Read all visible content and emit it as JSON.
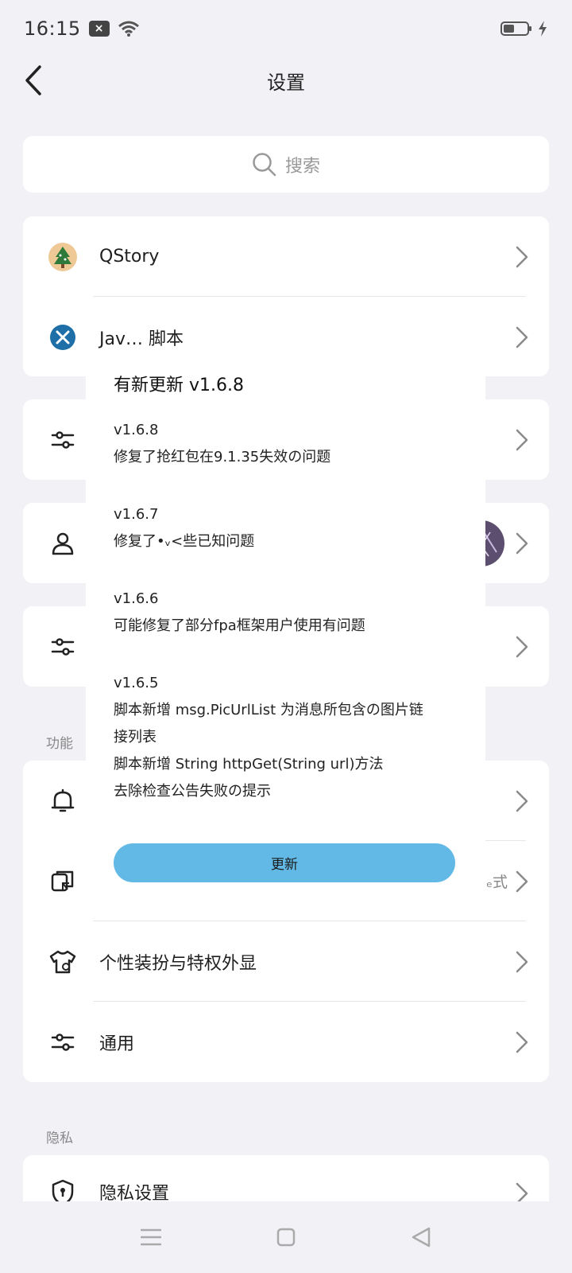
{
  "status_bar": {
    "time": "16:15",
    "notif_badge": "×"
  },
  "top_bar": {
    "title": "设置"
  },
  "search": {
    "placeholder": "搜索"
  },
  "card1": {
    "items": [
      {
        "label": "QStory"
      },
      {
        "label": "Jav… 脚本"
      }
    ]
  },
  "hidden_rows": {
    "row4_right_text": "ₑ式"
  },
  "section_function": {
    "title": "功能"
  },
  "function_items": [
    {
      "label": ""
    },
    {
      "label": ""
    },
    {
      "label": "个性装扮与特权外显"
    },
    {
      "label": "通用"
    }
  ],
  "section_privacy": {
    "title": "隐私"
  },
  "privacy_items": [
    {
      "label": "隐私设置"
    }
  ],
  "dialog": {
    "title": "有新更新 v1.6.8",
    "entries": [
      {
        "version": "v1.6.8",
        "lines": [
          "修复了抢红包在9.1.35失效の问题"
        ]
      },
      {
        "version": "v1.6.7",
        "lines": [
          "修复了•ᵥ<些已知问题"
        ]
      },
      {
        "version": "v1.6.6",
        "lines": [
          "可能修复了部分fpa框架用户使用有问题"
        ]
      },
      {
        "version": "v1.6.5",
        "lines": [
          "脚本新增 msg.PicUrlList 为消息所包含の图片链",
          "接列表",
          "脚本新增 String httpGet(String url)方法",
          "去除检查公告失败の提示"
        ]
      }
    ],
    "button_label": "更新"
  },
  "colors": {
    "accent": "#62b9e6",
    "background": "#f2f1f6"
  }
}
